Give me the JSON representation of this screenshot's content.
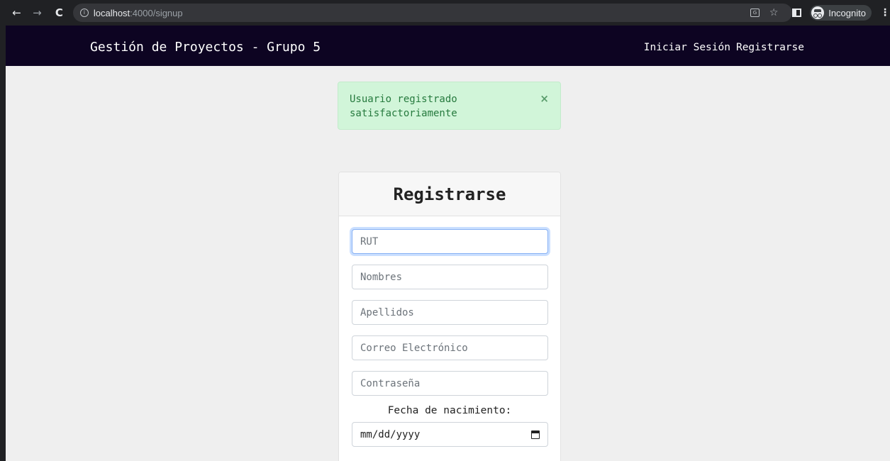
{
  "browser": {
    "url_host": "localhost",
    "url_rest": ":4000/signup",
    "incognito_label": "Incognito"
  },
  "navbar": {
    "brand": "Gestión de Proyectos - Grupo 5",
    "links": [
      "Iniciar Sesión",
      "Registrarse"
    ]
  },
  "alert": {
    "message": "Usuario registrado satisfactoriamente",
    "close": "×"
  },
  "form": {
    "title": "Registrarse",
    "rut_placeholder": "RUT",
    "nombres_placeholder": "Nombres",
    "apellidos_placeholder": "Apellidos",
    "correo_placeholder": "Correo Electrónico",
    "contrasena_placeholder": "Contraseña",
    "fecha_label": "Fecha de nacimiento:",
    "fecha_placeholder": "mm/dd/yyyy"
  },
  "colors": {
    "navbar_bg": "#0d0422",
    "alert_bg": "#d1f5d9",
    "alert_text": "#267a3e",
    "page_bg": "#efefef"
  }
}
